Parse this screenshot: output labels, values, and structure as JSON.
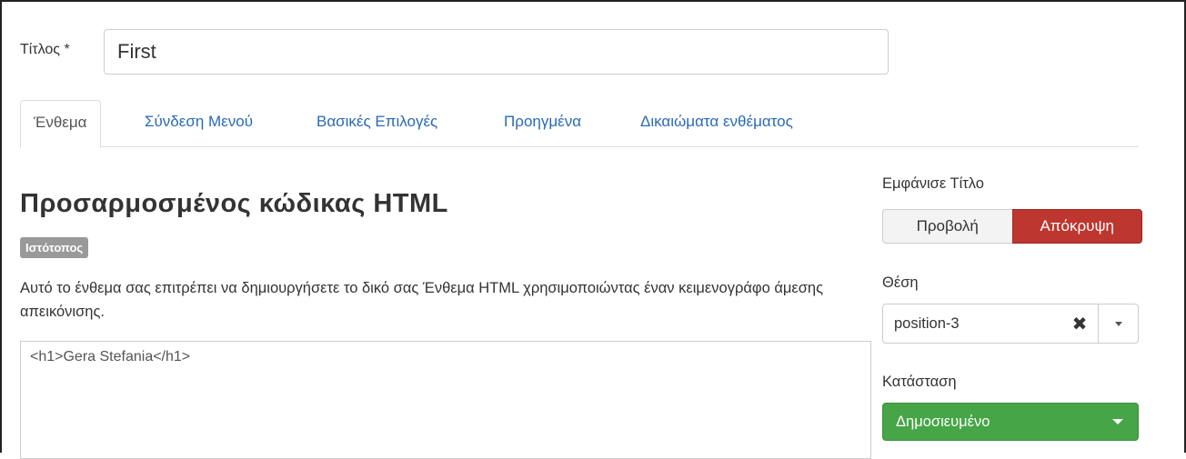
{
  "title_field": {
    "label": "Τίτλος *",
    "value": "First"
  },
  "tabs": [
    {
      "label": "Ένθεμα",
      "active": true
    },
    {
      "label": "Σύνδεση Μενού",
      "active": false
    },
    {
      "label": "Βασικές Επιλογές",
      "active": false
    },
    {
      "label": "Προηγμένα",
      "active": false
    },
    {
      "label": "Δικαιώματα ενθέματος",
      "active": false
    }
  ],
  "module": {
    "heading": "Προσαρμοσμένος κώδικας HTML",
    "badge": "Ιστότοπος",
    "description": "Αυτό το ένθεμα σας επιτρέπει να δημιουργήσετε το δικό σας Ένθεμα HTML χρησιμοποιώντας έναν κειμενογράφο άμεσης απεικόνισης.",
    "editor_content": "<h1>Gera Stefania</h1>"
  },
  "sidebar": {
    "show_title_label": "Εμφάνισε Τίτλο",
    "show_label": "Προβολή",
    "hide_label": "Απόκρυψη",
    "position_label": "Θέση",
    "position_value": "position-3",
    "status_label": "Κατάσταση",
    "status_value": "Δημοσιευμένο"
  },
  "colors": {
    "link": "#2a69b8",
    "hide_active": "#bd362f",
    "status_green": "#46a546",
    "badge_gray": "#999999"
  }
}
